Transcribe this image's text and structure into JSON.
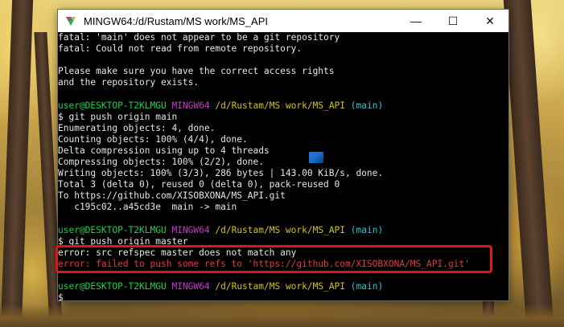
{
  "window": {
    "title": "MINGW64:/d/Rustam/MS work/MS_API",
    "controls": {
      "minimize": "—",
      "maximize": "☐",
      "close": "✕"
    }
  },
  "terminal": {
    "lines": [
      [
        {
          "t": "fatal: 'main' does not appear to be a git repository",
          "c": "w"
        }
      ],
      [
        {
          "t": "fatal: Could not read from remote repository.",
          "c": "w"
        }
      ],
      [
        {
          "t": "",
          "c": "w"
        }
      ],
      [
        {
          "t": "Please make sure you have the correct access rights",
          "c": "w"
        }
      ],
      [
        {
          "t": "and the repository exists.",
          "c": "w"
        }
      ],
      [
        {
          "t": "",
          "c": "w"
        }
      ],
      [
        {
          "t": "user@DESKTOP-T2KLMGU",
          "c": "g"
        },
        {
          "t": " ",
          "c": "w"
        },
        {
          "t": "MINGW64",
          "c": "m"
        },
        {
          "t": " ",
          "c": "w"
        },
        {
          "t": "/d/Rustam/MS work/MS_API",
          "c": "y"
        },
        {
          "t": " ",
          "c": "w"
        },
        {
          "t": "(main)",
          "c": "c"
        }
      ],
      [
        {
          "t": "$ git push origin main",
          "c": "w"
        }
      ],
      [
        {
          "t": "Enumerating objects: 4, done.",
          "c": "w"
        }
      ],
      [
        {
          "t": "Counting objects: 100% (4/4), done.",
          "c": "w"
        }
      ],
      [
        {
          "t": "Delta compression using up to 4 threads",
          "c": "w"
        }
      ],
      [
        {
          "t": "Compressing objects: 100% (2/2), done.",
          "c": "w"
        }
      ],
      [
        {
          "t": "Writing objects: 100% (3/3), 286 bytes | 143.00 KiB/s, done.",
          "c": "w"
        }
      ],
      [
        {
          "t": "Total 3 (delta 0), reused 0 (delta 0), pack-reused 0",
          "c": "w"
        }
      ],
      [
        {
          "t": "To https://github.com/XISOBXONA/MS_API.git",
          "c": "w"
        }
      ],
      [
        {
          "t": "   c195c02..a45cd3e  main -> main",
          "c": "w"
        }
      ],
      [
        {
          "t": "",
          "c": "w"
        }
      ],
      [
        {
          "t": "user@DESKTOP-T2KLMGU",
          "c": "g"
        },
        {
          "t": " ",
          "c": "w"
        },
        {
          "t": "MINGW64",
          "c": "m"
        },
        {
          "t": " ",
          "c": "w"
        },
        {
          "t": "/d/Rustam/MS work/MS_API",
          "c": "y"
        },
        {
          "t": " ",
          "c": "w"
        },
        {
          "t": "(main)",
          "c": "c"
        }
      ],
      [
        {
          "t": "$ git push origin master",
          "c": "w"
        }
      ],
      [
        {
          "t": "error: src refspec master does not match any",
          "c": "w"
        }
      ],
      [
        {
          "t": "error: failed to push some refs to 'https://github.com/XISOBXONA/MS_API.git'",
          "c": "r"
        }
      ],
      [
        {
          "t": "",
          "c": "w"
        }
      ],
      [
        {
          "t": "user@DESKTOP-T2KLMGU",
          "c": "g"
        },
        {
          "t": " ",
          "c": "w"
        },
        {
          "t": "MINGW64",
          "c": "m"
        },
        {
          "t": " ",
          "c": "w"
        },
        {
          "t": "/d/Rustam/MS work/MS_API",
          "c": "y"
        },
        {
          "t": " ",
          "c": "w"
        },
        {
          "t": "(main)",
          "c": "c"
        }
      ],
      [
        {
          "t": "$",
          "c": "w"
        }
      ]
    ]
  },
  "colors": {
    "terminal_bg": "#000000",
    "prompt_user": "#18d14a",
    "prompt_mingw": "#c33ac9",
    "prompt_path": "#d1c21a",
    "prompt_branch": "#2ec4c9",
    "error_text": "#e23b3b",
    "highlight_border": "#e01515"
  },
  "icons": {
    "app": "git-bash-icon"
  }
}
